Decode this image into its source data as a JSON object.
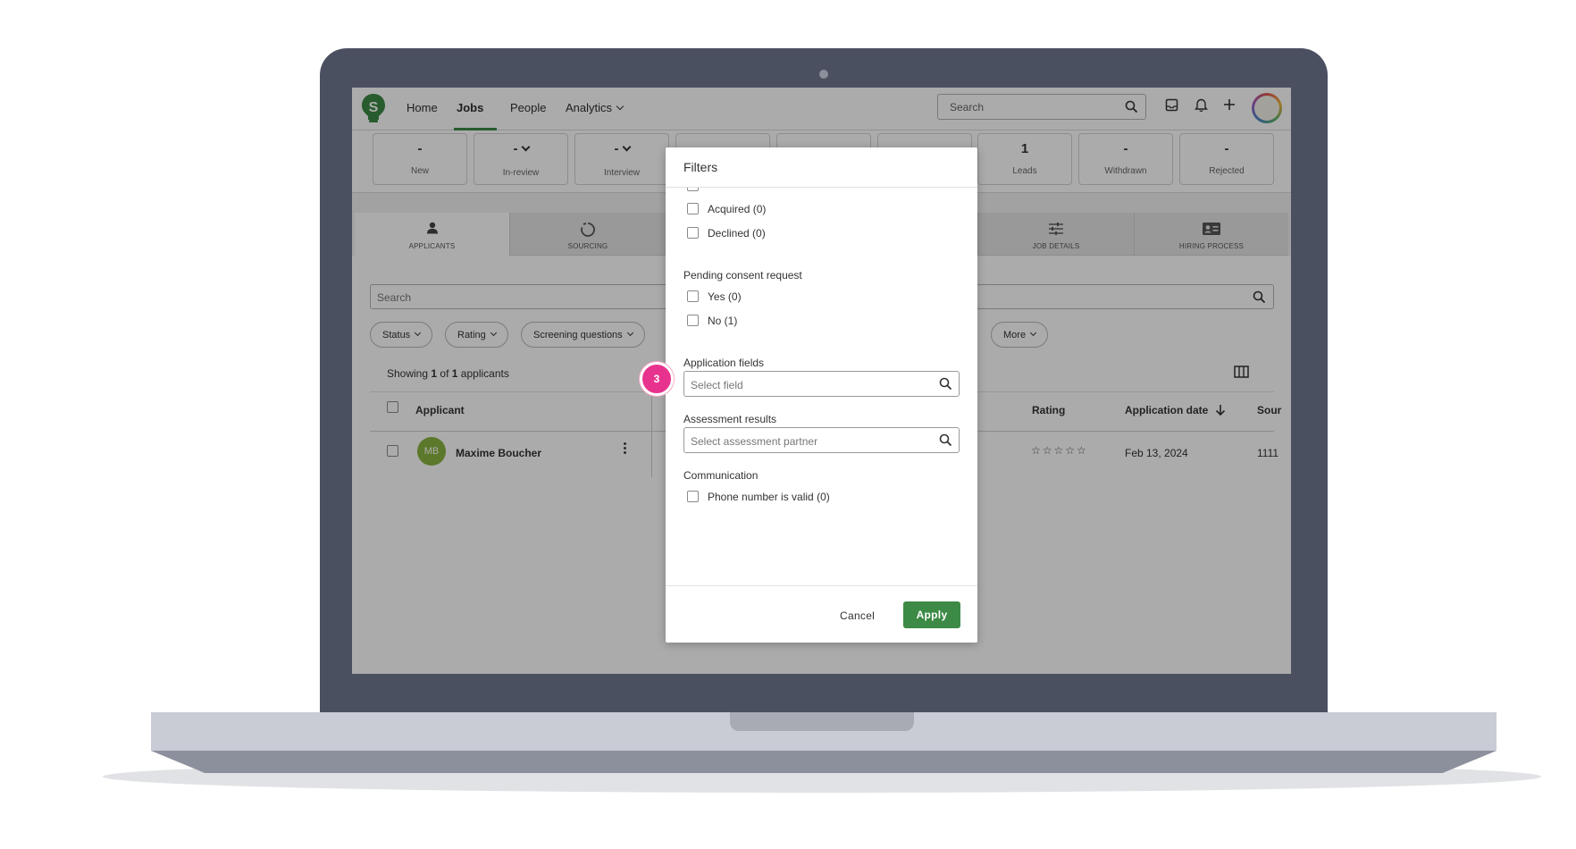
{
  "nav": {
    "links": [
      "Home",
      "Jobs",
      "People",
      "Analytics"
    ],
    "search_placeholder": "Search"
  },
  "stages": [
    {
      "count": "-",
      "label": "New"
    },
    {
      "count": "-",
      "label": "In-review"
    },
    {
      "count": "-",
      "label": "Interview"
    },
    {
      "count": "",
      "label": ""
    },
    {
      "count": "",
      "label": ""
    },
    {
      "count": "",
      "label": ""
    },
    {
      "count": "1",
      "label": "Leads"
    },
    {
      "count": "-",
      "label": "Withdrawn"
    },
    {
      "count": "-",
      "label": "Rejected"
    }
  ],
  "tabs": [
    "APPLICANTS",
    "SOURCING",
    "JOB DETAILS",
    "HIRING PROCESS"
  ],
  "applicants": {
    "search_placeholder": "Search",
    "filters": [
      "Status",
      "Rating",
      "Screening questions",
      "More"
    ],
    "showing_prefix": "Showing",
    "showing_count": "1",
    "showing_of": "of",
    "showing_total": "1",
    "showing_suffix": "applicants",
    "columns": {
      "applicant": "Applicant",
      "rating": "Rating",
      "date": "Application date",
      "source": "Sour"
    },
    "rows": [
      {
        "initials": "MB",
        "name": "Maxime Boucher",
        "rating": "☆☆☆☆☆",
        "date": "Feb 13, 2024",
        "source": "1111"
      }
    ]
  },
  "modal": {
    "title": "Filters",
    "checkboxes_top": [
      "Acquired (0)",
      "Declined (0)"
    ],
    "consent_section": "Pending consent request",
    "consent_options": [
      "Yes (0)",
      "No (1)"
    ],
    "app_fields_section": "Application fields",
    "app_fields_placeholder": "Select field",
    "assessment_section": "Assessment results",
    "assessment_placeholder": "Select assessment partner",
    "communication_section": "Communication",
    "communication_options": [
      "Phone number is valid (0)"
    ],
    "cancel_label": "Cancel",
    "apply_label": "Apply"
  },
  "step_badge": "3",
  "colors": {
    "accent": "#3c8a45",
    "badge": "#e8338e",
    "laptop_frame": "#4b5061"
  },
  "icons": [
    "logo-icon",
    "search-icon",
    "inbox-icon",
    "bell-icon",
    "plus-icon",
    "user-icon",
    "sourcing-icon",
    "sliders-icon",
    "id-card-icon",
    "columns-icon",
    "kebab-icon",
    "sort-down-icon"
  ]
}
